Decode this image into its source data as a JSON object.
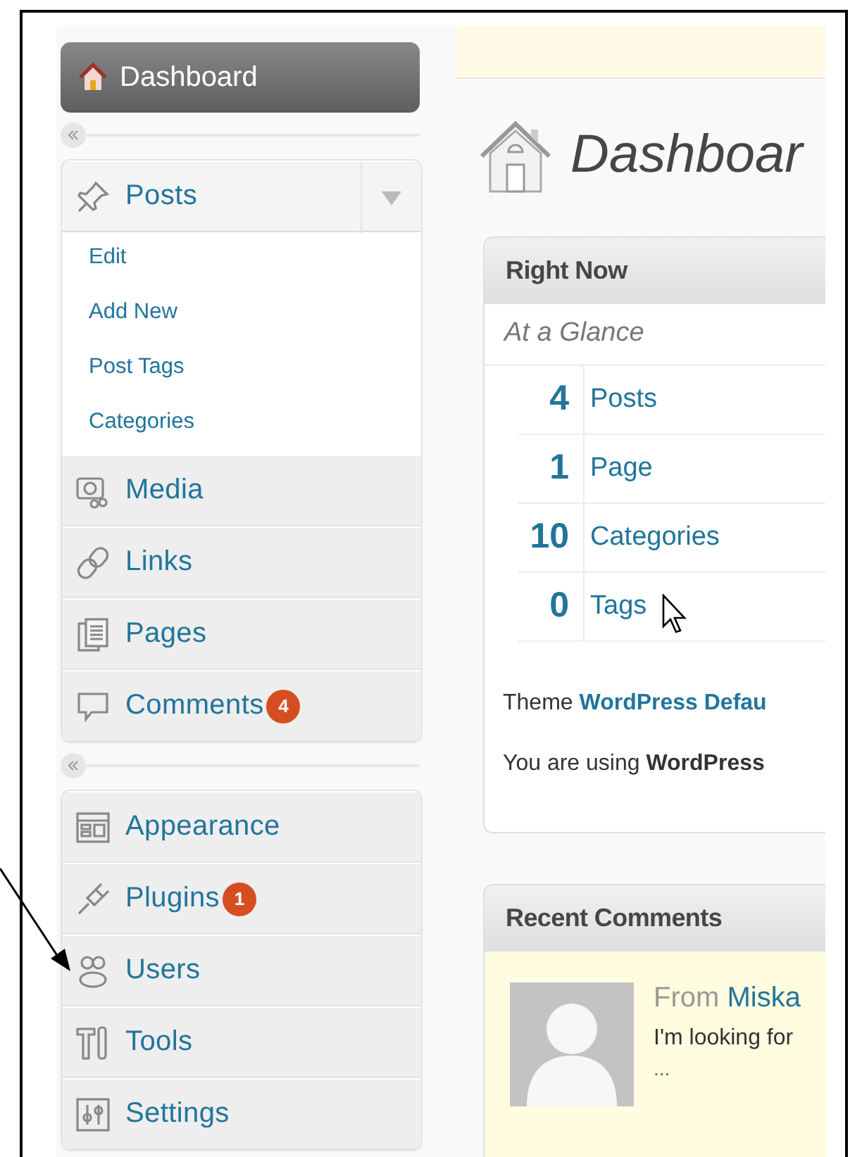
{
  "sidebar": {
    "groups": [
      {
        "items": [
          {
            "label": "Dashboard",
            "selected": true
          }
        ]
      },
      {
        "items": [
          {
            "label": "Posts",
            "selected": false,
            "expanded": true,
            "children": [
              {
                "label": "Edit"
              },
              {
                "label": "Add New"
              },
              {
                "label": "Post Tags"
              },
              {
                "label": "Categories"
              }
            ]
          },
          {
            "label": "Media",
            "selected": false,
            "expanded": false
          },
          {
            "label": "Links",
            "selected": false,
            "expanded": false
          },
          {
            "label": "Pages",
            "selected": false,
            "expanded": false
          },
          {
            "label": "Comments",
            "selected": false,
            "expanded": false,
            "count": "4"
          }
        ]
      },
      {
        "items": [
          {
            "label": "Appearance",
            "selected": false,
            "expanded": false
          },
          {
            "label": "Plugins",
            "selected": false,
            "expanded": false,
            "count": "1"
          },
          {
            "label": "Users",
            "selected": false,
            "expanded": false
          },
          {
            "label": "Tools",
            "selected": false,
            "expanded": false
          },
          {
            "label": "Settings",
            "selected": false,
            "expanded": false
          }
        ]
      }
    ]
  },
  "page_title": "Dashboar",
  "right_now": {
    "title": "Right Now",
    "subtitle": "At a Glance",
    "stats": [
      {
        "count": "4",
        "label": "Posts"
      },
      {
        "count": "1",
        "label": "Page"
      },
      {
        "count": "10",
        "label": "Categories"
      },
      {
        "count": "0",
        "label": "Tags"
      }
    ],
    "theme": {
      "prefix": "Theme",
      "link": "WordPress Defau"
    },
    "version": "You are using **WordPress**"
  },
  "recent_comments": {
    "title": "Recent Comments",
    "items": [
      {
        "from": "From",
        "author": "Miska",
        "excerpt": "I'm looking for",
        "more": "..."
      }
    ]
  }
}
